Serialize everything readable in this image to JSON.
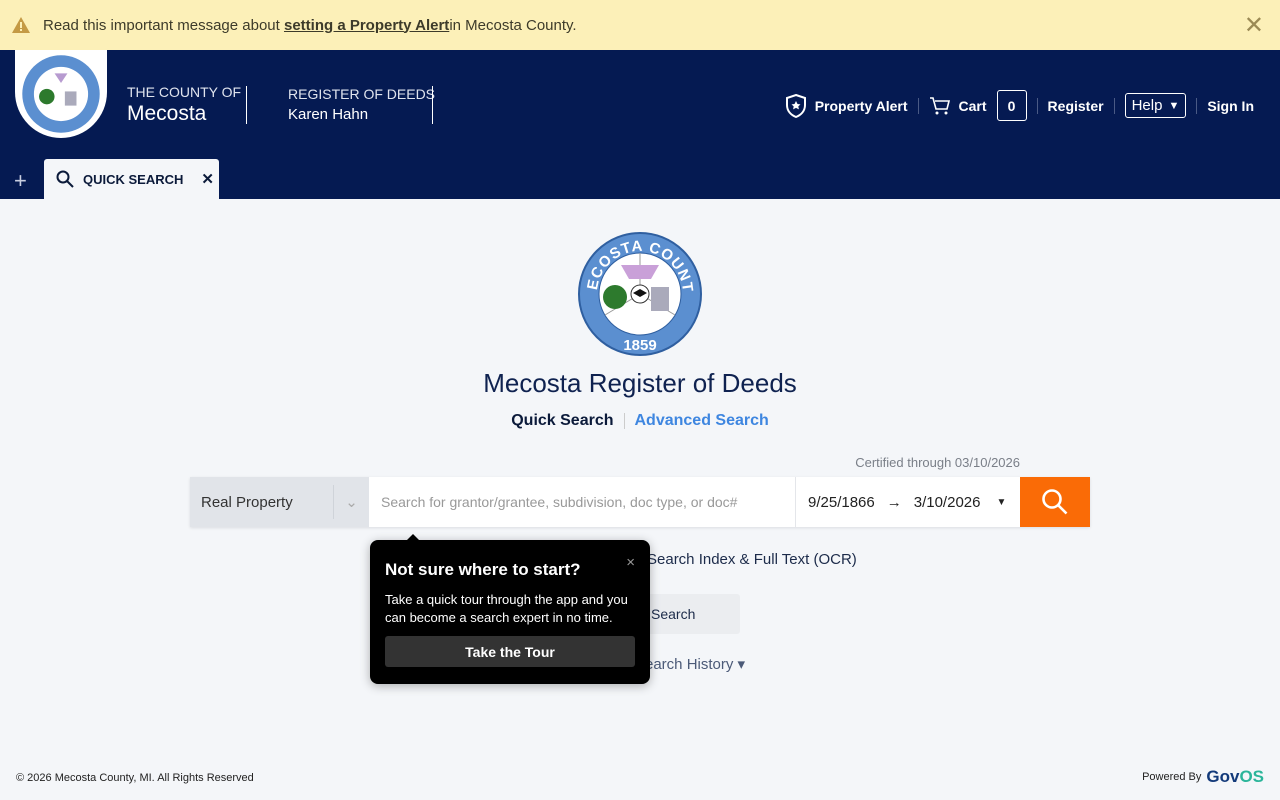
{
  "alert": {
    "prefix": "Read this important message about ",
    "link": "setting a Property Alert",
    "suffix": " in Mecosta County.",
    "icon": "warning-icon",
    "close": "✕"
  },
  "header": {
    "county_small": "THE COUNTY OF",
    "county_name": "Mecosta",
    "office": "REGISTER OF DEEDS",
    "officer": "Karen Hahn",
    "nav": {
      "property_alert": "Property Alert",
      "cart": "Cart",
      "cart_count": "0",
      "register": "Register",
      "help": "Help",
      "sign_in": "Sign In"
    }
  },
  "seal": {
    "top_text": "MECOSTA COUNTY",
    "year": "1859"
  },
  "tabs": {
    "add": "+",
    "items": [
      {
        "label": "QUICK SEARCH",
        "close": "✕"
      }
    ]
  },
  "main": {
    "title": "Mecosta Register of Deeds",
    "mode_quick": "Quick Search",
    "mode_advanced": "Advanced Search",
    "certified": "Certified through 03/10/2026",
    "search": {
      "type": "Real Property",
      "placeholder": "Search for grantor/grantee, subdivision, doc type, or doc#",
      "from": "9/25/1866",
      "arrow": "→",
      "to": "3/10/2026"
    },
    "option_text": "Search Index & Full Text (OCR)",
    "secondary_button": "Search",
    "history": "earch History ▾"
  },
  "tour": {
    "title": "Not sure where to start?",
    "body": "Take a quick tour through the app and you can become a search expert in no time.",
    "button": "Take the Tour",
    "close": "×"
  },
  "footer": {
    "copyright": "© 2026 Mecosta County, MI. All Rights Reserved",
    "powered": "Powered By",
    "brand_a": "Gov",
    "brand_b": "OS"
  },
  "colors": {
    "header": "#051a52",
    "alert": "#fcf0b8",
    "accent": "#fa6b06",
    "link": "#3e86e0"
  }
}
